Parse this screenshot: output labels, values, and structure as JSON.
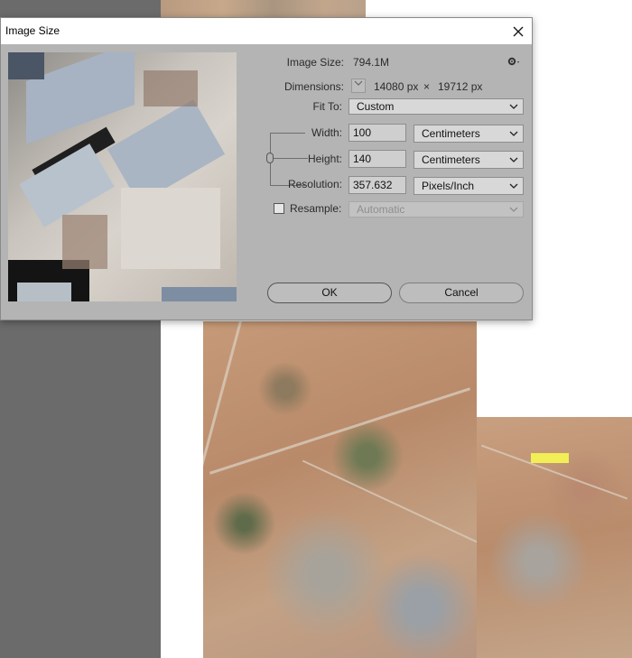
{
  "dialog": {
    "title": "Image Size",
    "close_glyph": "×",
    "settings_icon": "gear-icon"
  },
  "image_size": {
    "label": "Image Size:",
    "value": "794.1M"
  },
  "dimensions": {
    "label": "Dimensions:",
    "width": "14080 px",
    "times": "×",
    "height": "19712 px"
  },
  "fit_to": {
    "label": "Fit To:",
    "value": "Custom"
  },
  "width": {
    "label": "Width:",
    "value": "100",
    "unit": "Centimeters"
  },
  "height": {
    "label": "Height:",
    "value": "140",
    "unit": "Centimeters"
  },
  "resolution": {
    "label": "Resolution:",
    "value": "357.632",
    "unit": "Pixels/Inch"
  },
  "resample": {
    "label": "Resample:",
    "checked": false,
    "value": "Automatic"
  },
  "buttons": {
    "ok": "OK",
    "cancel": "Cancel"
  },
  "colors": {
    "dialog_bg": "#b4b4b4",
    "titlebar_bg": "#ffffff",
    "canvas_gray": "#6b6b6b"
  }
}
